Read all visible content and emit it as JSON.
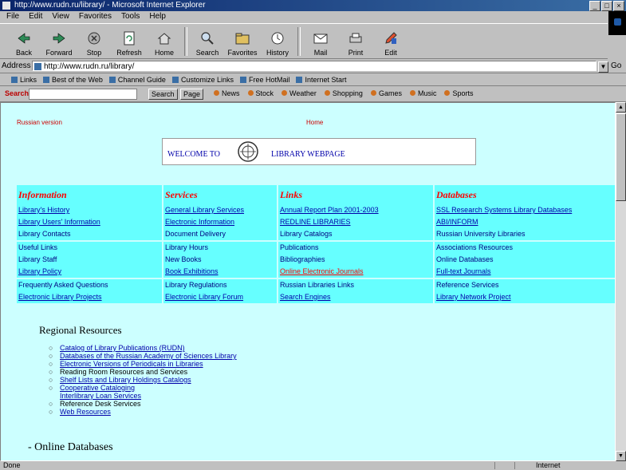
{
  "window": {
    "title": "http://www.rudn.ru/library/ - Microsoft Internet Explorer"
  },
  "menu": [
    "File",
    "Edit",
    "View",
    "Favorites",
    "Tools",
    "Help"
  ],
  "toolbar": [
    {
      "label": "Back",
      "icon": "back-arrow-icon"
    },
    {
      "label": "Forward",
      "icon": "forward-arrow-icon"
    },
    {
      "label": "Stop",
      "icon": "stop-icon"
    },
    {
      "label": "Refresh",
      "icon": "refresh-icon"
    },
    {
      "label": "Home",
      "icon": "home-icon"
    },
    {
      "label": "Search",
      "icon": "search-icon"
    },
    {
      "label": "Favorites",
      "icon": "favorites-icon"
    },
    {
      "label": "History",
      "icon": "history-icon"
    },
    {
      "label": "Mail",
      "icon": "mail-icon"
    },
    {
      "label": "Print",
      "icon": "print-icon"
    },
    {
      "label": "Edit",
      "icon": "edit-icon"
    }
  ],
  "address": {
    "label": "Address",
    "value": "http://www.rudn.ru/library/",
    "go": "Go"
  },
  "links": [
    "Links",
    "Best of the Web",
    "Channel Guide",
    "Customize Links",
    "Free HotMail",
    "Internet Start"
  ],
  "searchbar": {
    "logo": "Search",
    "search_btn": "Search",
    "page_btn": "Page",
    "items": [
      "News",
      "Stock",
      "Weather",
      "Shopping",
      "Games",
      "Music",
      "Sports"
    ]
  },
  "page": {
    "toplinks": [
      "Russian version",
      "Home"
    ],
    "banner": {
      "left": "WELCOME TO",
      "right": "LIBRARY WEBPAGE"
    },
    "columns": [
      "Information",
      "Services",
      "Links",
      "Databases"
    ],
    "rows": [
      [
        "Library's History",
        "General Library Services",
        "Annual Report Plan 2001-2003",
        "SSL Research Systems Library Databases"
      ],
      [
        "Library Users' Information",
        "Electronic Information",
        "REDLINE LIBRARIES",
        "ABI/INFORM"
      ],
      [
        "Library Contacts",
        "Document Delivery",
        "Library Catalogs",
        "Russian University Libraries"
      ],
      [
        "Useful Links",
        "Library Hours",
        "Publications",
        "Associations Resources"
      ],
      [
        "Library Staff",
        "New Books",
        "Bibliographies",
        "Online Databases"
      ],
      [
        "Library Policy",
        "Book Exhibitions",
        "Online Electronic Journals",
        "Full-text Journals"
      ],
      [
        "Frequently Asked Questions",
        "Library Regulations",
        "Russian Libraries Links",
        "Reference Services"
      ],
      [
        "Electronic Library Projects",
        "Electronic Library Forum",
        "Search Engines",
        "Library Network Project"
      ]
    ],
    "section1": "Regional Resources",
    "resources": [
      "Catalog of Library Publications (RUDN)",
      "Databases of the Russian Academy of Sciences Library",
      "Electronic Versions of Periodicals in Libraries",
      "Reading Room Resources and Services",
      "Shelf Lists and Library Holdings Catalogs",
      "Cooperative Cataloging",
      "Interlibrary Loan Services",
      "Reference Desk Services",
      "Web Resources"
    ],
    "section2": "Online Databases"
  },
  "status": {
    "text": "Done",
    "zone": "Internet"
  }
}
